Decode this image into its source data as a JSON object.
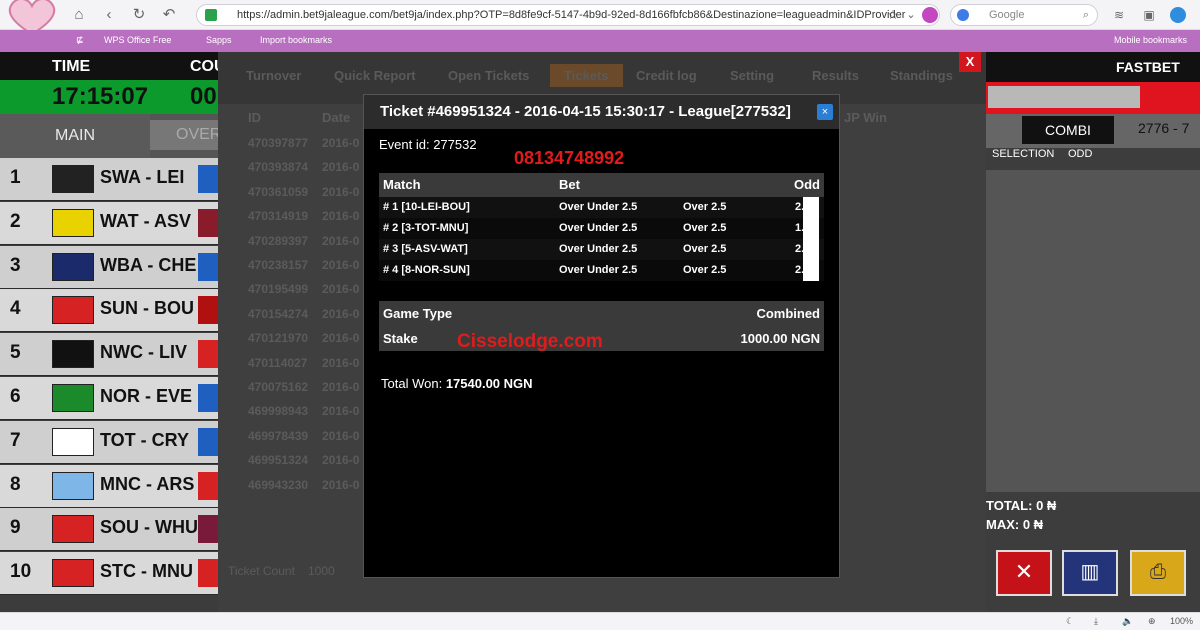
{
  "browser": {
    "url": "https://admin.bet9jaleague.com/bet9ja/index.php?OTP=8d8fe9cf-5147-4b9d-92ed-8d166fbfcb86&Destinazione=leagueadmin&IDProvider",
    "search_placeholder": "Google",
    "bookmarks": [
      "WPS Office Free",
      "Sapps",
      "Import bookmarks"
    ],
    "mobile_bookmarks": "Mobile bookmarks",
    "zoom": "100%"
  },
  "left_panel": {
    "time_label": "TIME",
    "countdown_label": "COU",
    "time_value": "17:15:07",
    "countdown_value": "00",
    "tab_main": "MAIN",
    "tab_over": "OVER",
    "races": [
      {
        "num": "1",
        "match": "SWA - LEI",
        "kit": "#222",
        "kit2": "#1f5fbf"
      },
      {
        "num": "2",
        "match": "WAT - ASV",
        "kit": "#e8d200",
        "kit2": "#8a1b2b"
      },
      {
        "num": "3",
        "match": "WBA - CHE",
        "kit": "#1b2a6b",
        "kit2": "#1f5fbf"
      },
      {
        "num": "4",
        "match": "SUN - BOU",
        "kit": "#d62222",
        "kit2": "#b01010"
      },
      {
        "num": "5",
        "match": "NWC - LIV",
        "kit": "#111",
        "kit2": "#d62222"
      },
      {
        "num": "6",
        "match": "NOR - EVE",
        "kit": "#1a8a2a",
        "kit2": "#1f5fbf"
      },
      {
        "num": "7",
        "match": "TOT - CRY",
        "kit": "#ffffff",
        "kit2": "#1f5fbf"
      },
      {
        "num": "8",
        "match": "MNC - ARS",
        "kit": "#7fb6e8",
        "kit2": "#d62222"
      },
      {
        "num": "9",
        "match": "SOU - WHU",
        "kit": "#d62222",
        "kit2": "#7a1a3a"
      },
      {
        "num": "10",
        "match": "STC - MNU",
        "kit": "#d62222",
        "kit2": "#d62222"
      }
    ]
  },
  "middle": {
    "tabs": [
      "Turnover",
      "Quick Report",
      "Open Tickets",
      "Tickets",
      "Credit log",
      "Setting",
      "Results",
      "Standings"
    ],
    "col_id": "ID",
    "col_date": "Date",
    "jp_win": "JP Win",
    "ids": [
      "470397877",
      "470393874",
      "470361059",
      "470314919",
      "470289397",
      "470238157",
      "470195499",
      "470154274",
      "470121970",
      "470114027",
      "470075162",
      "469998943",
      "469978439",
      "469951324",
      "469943230"
    ],
    "date_prefix": "2016-0",
    "ticket_count_label": "Ticket Count",
    "ticket_count": "1000"
  },
  "modal": {
    "title": "Ticket #469951324 - 2016-04-15 15:30:17 - League[277532]",
    "close": "×",
    "event_id": "Event id: 277532",
    "phone": "08134748992",
    "headers": {
      "match": "Match",
      "bet": "Bet",
      "odd": "Odd"
    },
    "rows": [
      {
        "match": "# 1 [10-LEI-BOU]",
        "bet": "Over Under 2.5",
        "pick": "Over 2.5",
        "odd": "2."
      },
      {
        "match": "# 2 [3-TOT-MNU]",
        "bet": "Over Under 2.5",
        "pick": "Over 2.5",
        "odd": "1."
      },
      {
        "match": "# 3 [5-ASV-WAT]",
        "bet": "Over Under 2.5",
        "pick": "Over 2.5",
        "odd": "2."
      },
      {
        "match": "# 4 [8-NOR-SUN]",
        "bet": "Over Under 2.5",
        "pick": "Over 2.5",
        "odd": "2."
      }
    ],
    "game_type_label": "Game Type",
    "game_type": "Combined",
    "stake_label": "Stake",
    "stake": "1000.00 NGN",
    "watermark": "Cisselodge.com",
    "total_won_label": "Total Won:",
    "total_won": "17540.00 NGN"
  },
  "right_panel": {
    "title": "FASTBET",
    "combi": "COMBI",
    "code": "2776 - 7",
    "selection": "SELECTION",
    "odd": "ODD",
    "total": "TOTAL: 0 ₦",
    "max": "MAX: 0 ₦"
  },
  "overlay_close": "X"
}
